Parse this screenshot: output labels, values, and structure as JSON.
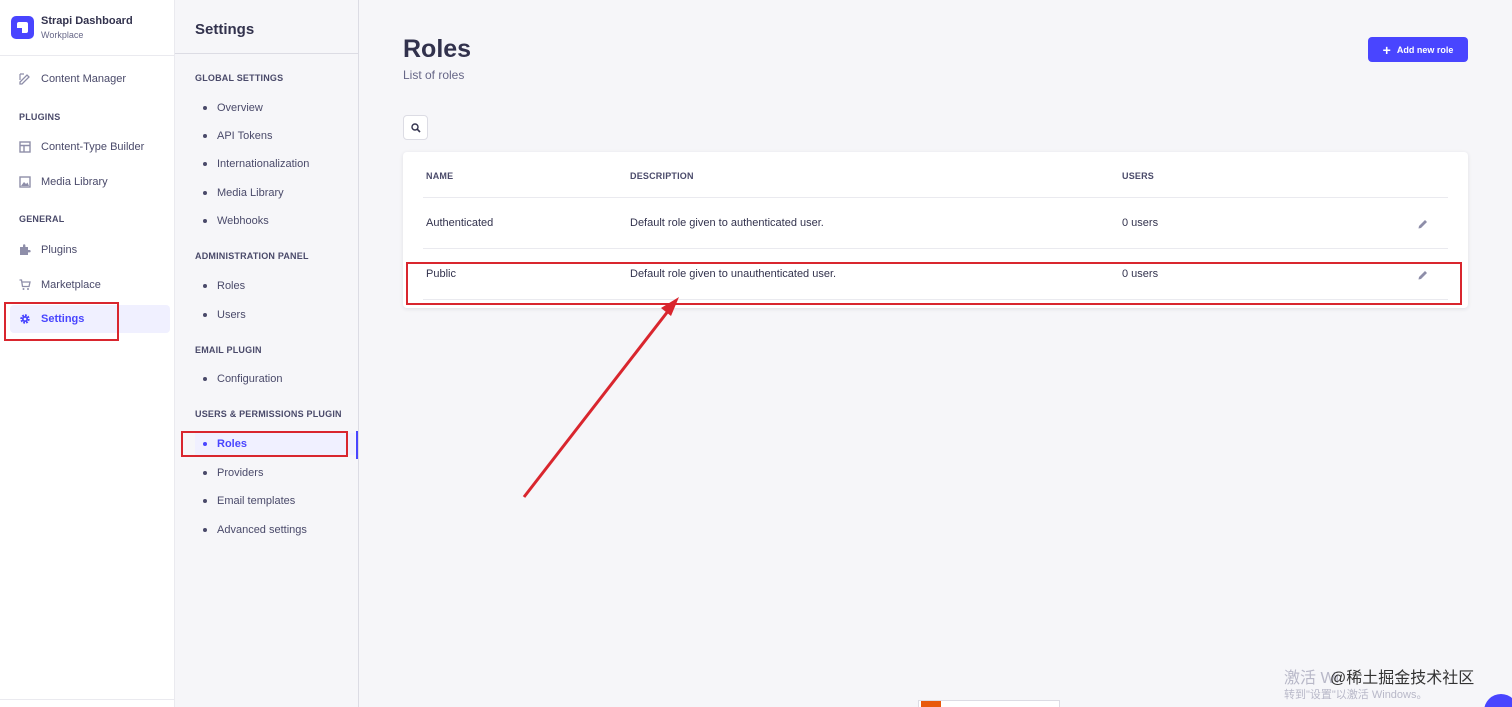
{
  "brand": {
    "name": "Strapi Dashboard",
    "workspace": "Workplace"
  },
  "mainnav": {
    "content_manager": "Content Manager",
    "plugins_section": "PLUGINS",
    "content_type_builder": "Content-Type Builder",
    "media_library": "Media Library",
    "general_section": "GENERAL",
    "plugins": "Plugins",
    "marketplace": "Marketplace",
    "settings": "Settings"
  },
  "subnav": {
    "title": "Settings",
    "global_settings": {
      "label": "GLOBAL SETTINGS",
      "items": [
        "Overview",
        "API Tokens",
        "Internationalization",
        "Media Library",
        "Webhooks"
      ]
    },
    "administration_panel": {
      "label": "ADMINISTRATION PANEL",
      "items": [
        "Roles",
        "Users"
      ]
    },
    "email_plugin": {
      "label": "EMAIL PLUGIN",
      "items": [
        "Configuration"
      ]
    },
    "users_permissions": {
      "label": "USERS & PERMISSIONS PLUGIN",
      "items": [
        "Roles",
        "Providers",
        "Email templates",
        "Advanced settings"
      ]
    }
  },
  "main": {
    "title": "Roles",
    "subtitle": "List of roles",
    "add_button": "Add new role",
    "table": {
      "headers": {
        "name": "NAME",
        "description": "DESCRIPTION",
        "users": "USERS"
      },
      "rows": [
        {
          "name": "Authenticated",
          "description": "Default role given to authenticated user.",
          "users": "0 users"
        },
        {
          "name": "Public",
          "description": "Default role given to unauthenticated user.",
          "users": "0 users"
        }
      ]
    }
  },
  "watermark": {
    "activate": "激活 Wi",
    "site": "@稀土掘金技术社区",
    "hint": "转到\"设置\"以激活 Windows。"
  },
  "colors": {
    "accent": "#4945ff",
    "annotation": "#d9262e"
  }
}
